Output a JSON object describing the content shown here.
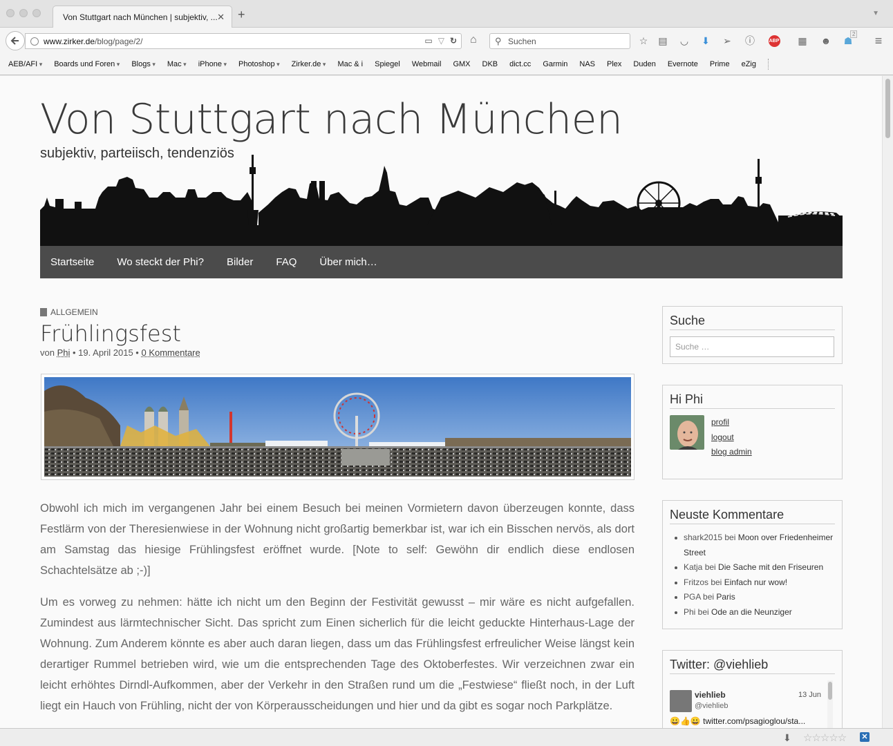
{
  "browser": {
    "tab_title": "Von Stuttgart nach München | subjektiv, ...",
    "tab_close": "✕",
    "new_tab": "+",
    "url_domain": "www.zirker.de",
    "url_path": "/blog/page/2/",
    "search_placeholder": "Suchen",
    "extension_badge": "2"
  },
  "bookmarks": [
    {
      "label": "AEB/AFI",
      "dropdown": true
    },
    {
      "label": "Boards und Foren",
      "dropdown": true
    },
    {
      "label": "Blogs",
      "dropdown": true
    },
    {
      "label": "Mac",
      "dropdown": true
    },
    {
      "label": "iPhone",
      "dropdown": true
    },
    {
      "label": "Photoshop",
      "dropdown": true
    },
    {
      "label": "Zirker.de",
      "dropdown": true
    },
    {
      "label": "Mac & i",
      "dropdown": false
    },
    {
      "label": "Spiegel",
      "dropdown": false
    },
    {
      "label": "Webmail",
      "dropdown": false
    },
    {
      "label": "GMX",
      "dropdown": false
    },
    {
      "label": "DKB",
      "dropdown": false
    },
    {
      "label": "dict.cc",
      "dropdown": false
    },
    {
      "label": "Garmin",
      "dropdown": false
    },
    {
      "label": "NAS",
      "dropdown": false
    },
    {
      "label": "Plex",
      "dropdown": false
    },
    {
      "label": "Duden",
      "dropdown": false
    },
    {
      "label": "Evernote",
      "dropdown": false
    },
    {
      "label": "Prime",
      "dropdown": false
    },
    {
      "label": "eZig",
      "dropdown": false
    }
  ],
  "site": {
    "title": "Von Stuttgart nach München",
    "tagline": "subjektiv, parteiisch, tendenziös"
  },
  "nav": [
    "Startseite",
    "Wo steckt der Phi?",
    "Bilder",
    "FAQ",
    "Über mich…"
  ],
  "post": {
    "category": "ALLGEMEIN",
    "title": "Frühlingsfest",
    "meta_prefix": "von",
    "author": "Phi",
    "date": "• 19. April 2015 •",
    "comments": "0 Kommentare",
    "paragraphs": [
      "Obwohl ich mich im vergangenen Jahr bei einem Besuch bei meinen Vormietern davon überzeugen konnte, dass Festlärm von der Theresienwiese in der Wohnung nicht großartig bemerkbar ist, war ich ein Bisschen nervös, als dort am Samstag das hiesige Frühlingsfest eröffnet wurde. [Note to self: Gewöhn dir endlich diese endlosen Schachtelsätze ab ;-)]",
      "Um es vorweg zu nehmen: hätte ich nicht um den Beginn der Festivität gewusst – mir wäre es nicht aufgefallen. Zumindest aus lärmtechnischer Sicht. Das spricht zum Einen sicherlich für die leicht geduckte Hinterhaus-Lage der Wohnung. Zum Anderem könnte es aber auch daran liegen, dass um das Frühlingsfest erfreulicher Weise längst kein derartiger Rummel betrieben wird, wie um die entsprechenden Tage des Oktoberfestes. Wir verzeichnen zwar ein leicht erhöhtes Dirndl-Aufkommen, aber der Verkehr in den Straßen rund um die „Festwiese“ fließt noch, in der Luft liegt ein Hauch von Frühling, nicht der von Körperausscheidungen und hier und da gibt es sogar noch Parkplätze."
    ]
  },
  "sidebar": {
    "search": {
      "title": "Suche",
      "placeholder": "Suche …"
    },
    "hi": {
      "title": "Hi Phi",
      "links": [
        "profil",
        "logout",
        "blog admin"
      ]
    },
    "comments": {
      "title": "Neuste Kommentare",
      "items": [
        {
          "who": "shark2015",
          "sep": " bei ",
          "where": "Moon over Friedenheimer Street"
        },
        {
          "who": "Katja",
          "sep": " bei ",
          "where": "Die Sache mit den Friseuren"
        },
        {
          "who": "Fritzos",
          "sep": " bei ",
          "where": "Einfach nur wow!"
        },
        {
          "who": "PGA",
          "sep": " bei ",
          "where": "Paris"
        },
        {
          "who": "Phi",
          "sep": " bei ",
          "where": "Ode an die Neunziger"
        }
      ]
    },
    "twitter": {
      "title": "Twitter: @viehlieb",
      "name": "viehlieb",
      "handle": "@viehlieb",
      "date": "13 Jun",
      "text": "😀👍😀 twitter.com/psagioglou/sta..."
    }
  },
  "colors": {
    "nav_bg": "#4b4b4b",
    "accent_blue": "#2a6fb5"
  }
}
